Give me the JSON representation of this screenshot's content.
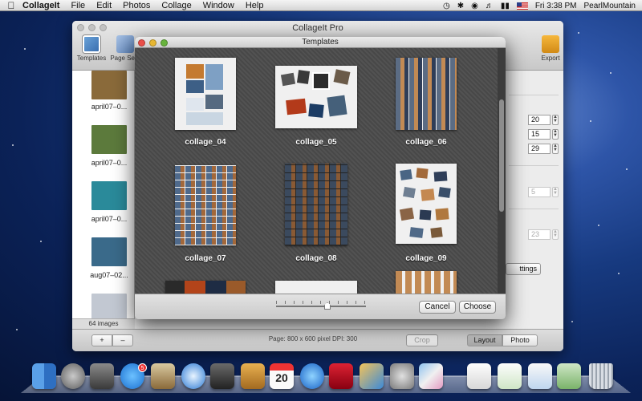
{
  "menubar": {
    "app_name": "CollageIt",
    "menus": [
      "File",
      "Edit",
      "Photos",
      "Collage",
      "Window",
      "Help"
    ],
    "clock": "Fri 3:38 PM",
    "user": "PearlMountain"
  },
  "main_window": {
    "title": "CollageIt Pro",
    "toolbar": {
      "templates": "Templates",
      "page_setup": "Page Setu",
      "export": "Export"
    },
    "sidebar": {
      "items": [
        {
          "label": "april07–0...",
          "color": "#8a6a3a"
        },
        {
          "label": "april07–0...",
          "color": "#5c7a3c"
        },
        {
          "label": "april07–0...",
          "color": "#2a8a9a"
        },
        {
          "label": "aug07–02...",
          "color": "#3a6a8a"
        },
        {
          "label": "",
          "color": "#c2c8d2"
        }
      ],
      "count": "64 images",
      "add": "+",
      "remove": "–"
    },
    "right_panel": {
      "field1": "20",
      "field2": "15",
      "field3": "29",
      "field4": "5",
      "field5": "23",
      "settings_label": "ttings"
    },
    "bottom": {
      "page_info": "Page: 800 x 600 pixel DPI: 300",
      "crop": "Crop",
      "layout": "Layout",
      "photo": "Photo"
    }
  },
  "templates_dialog": {
    "title": "Templates",
    "templates": [
      "collage_04",
      "collage_05",
      "collage_06",
      "collage_07",
      "collage_08",
      "collage_09"
    ],
    "cancel": "Cancel",
    "choose": "Choose"
  },
  "dock": {
    "icons": [
      "finder-icon",
      "launchpad-icon",
      "photo-booth-icon",
      "app-store-icon",
      "mail-icon",
      "safari-icon",
      "facetime-icon",
      "address-book-icon",
      "calendar-icon",
      "itunes-icon",
      "photo-slideshow-icon",
      "iphoto-icon",
      "system-preferences-icon",
      "collageit-icon",
      "documents-icon",
      "preview-icon",
      "mail-photo-icon",
      "trash-icon"
    ],
    "calendar_day": "20",
    "app_store_badge": "5"
  }
}
